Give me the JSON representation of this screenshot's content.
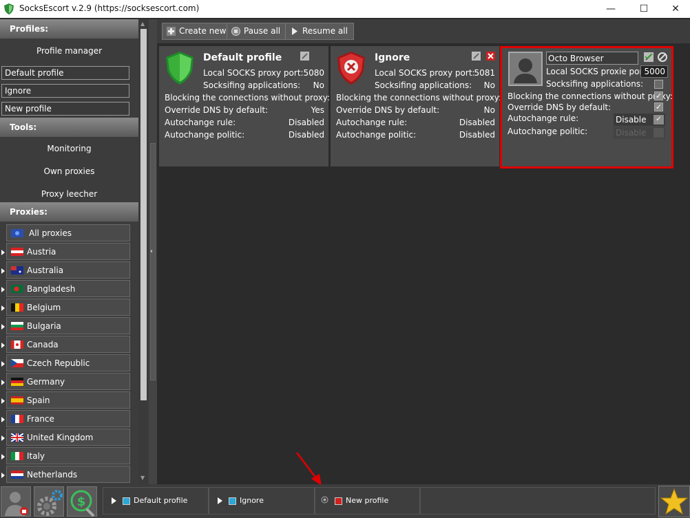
{
  "window": {
    "title": "SocksEscort v.2.9  (https://socksescort.com)",
    "minimize": "—",
    "maximize": "☐",
    "close": "✕"
  },
  "sidebar": {
    "profiles_header": "Profiles:",
    "profile_manager": "Profile manager",
    "profiles": [
      "Default profile",
      "Ignore",
      "New profile"
    ],
    "tools_header": "Tools:",
    "tools": [
      "Monitoring",
      "Own proxies",
      "Proxy leecher"
    ],
    "proxies_header": "Proxies:",
    "all_proxies": "All proxies",
    "countries": [
      "Austria",
      "Australia",
      "Bangladesh",
      "Belgium",
      "Bulgaria",
      "Canada",
      "Czech Republic",
      "Germany",
      "Spain",
      "France",
      "United Kingdom",
      "Italy",
      "Netherlands"
    ]
  },
  "toolbar": {
    "create_new": "Create new",
    "pause_all": "Pause all",
    "resume_all": "Resume all"
  },
  "cards": {
    "default": {
      "name": "Default profile",
      "port_label": "Local SOCKS proxy port:",
      "port": "5080",
      "socks_label": "Socksifing applications:",
      "socks": "No",
      "blocking": "Blocking the connections without proxy: Yes",
      "dns_label": "Override DNS by default:",
      "dns": "Yes",
      "rule_label": "Autochange rule:",
      "rule": "Disabled",
      "politic_label": "Autochange politic:",
      "politic": "Disabled"
    },
    "ignore": {
      "name": "Ignore",
      "port_label": "Local SOCKS proxy port:",
      "port": "5081",
      "socks_label": "Socksifing applications:",
      "socks": "No",
      "blocking": "Blocking the connections without proxy: No",
      "dns_label": "Override DNS by default:",
      "dns": "No",
      "rule_label": "Autochange rule:",
      "rule": "Disabled",
      "politic_label": "Autochange politic:",
      "politic": "Disabled"
    },
    "octo": {
      "name_value": "Octo Browser",
      "port_label": "Local SOCKS proxie port:",
      "port_value": "5000",
      "socks_label": "Socksifing applications:",
      "blocking_label": "Blocking the connections without proxy:",
      "dns_label": "Override DNS by default:",
      "rule_label": "Autochange rule:",
      "rule_value": "Disable",
      "politic_label": "Autochange politic:",
      "politic_value": "Disable",
      "blocking_checked": true,
      "dns_checked": true,
      "socks_checked": false
    }
  },
  "bottom_tabs": [
    {
      "label": "Default profile",
      "state": "running",
      "color": "#2aa8d8"
    },
    {
      "label": "Ignore",
      "state": "running",
      "color": "#2aa8d8"
    },
    {
      "label": "New profile",
      "state": "stopped",
      "color": "#d02020"
    }
  ],
  "colors": {
    "highlight_border": "#e00000",
    "annotation_arrow": "#e00000"
  }
}
